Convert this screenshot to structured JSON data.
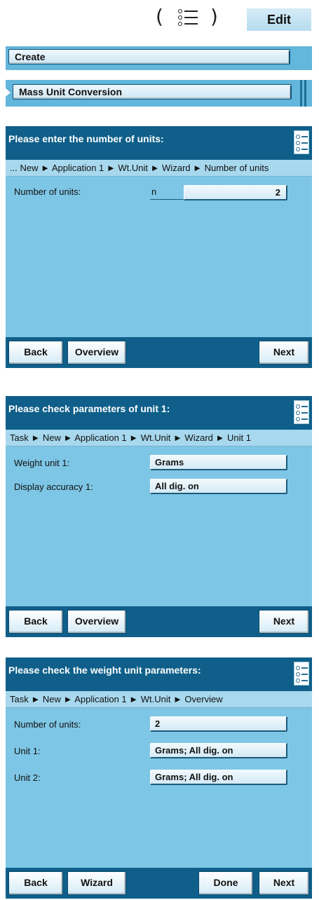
{
  "top_bar": {
    "paren_left": "(",
    "paren_right": ")",
    "menu_icon": "list-icon",
    "edit_label": "Edit"
  },
  "create_bar": {
    "label": "Create"
  },
  "mass_bar": {
    "label": "Mass Unit Conversion",
    "expanded_icon": "play-triangle-icon"
  },
  "screen1": {
    "title": "Please enter the number of units:",
    "breadcrumb": "... New ► Application 1 ► Wt.Unit ► Wizard ► Number of units",
    "fields": [
      {
        "label": "Number of units:",
        "prefix": "n",
        "value": "2"
      }
    ],
    "footer": {
      "back": "Back",
      "overview": "Overview",
      "next": "Next"
    }
  },
  "screen2": {
    "title": "Please check parameters of unit 1:",
    "breadcrumb": "Task ► New ► Application 1 ► Wt.Unit ► Wizard ► Unit 1",
    "fields": [
      {
        "label": "Weight unit 1:",
        "value": "Grams"
      },
      {
        "label": "Display accuracy 1:",
        "value": "All dig. on"
      }
    ],
    "footer": {
      "back": "Back",
      "overview": "Overview",
      "next": "Next"
    }
  },
  "screen3": {
    "title": "Please check the weight unit parameters:",
    "breadcrumb": "Task ► New ► Application 1 ► Wt.Unit ► Overview",
    "fields": [
      {
        "label": "Number of units:",
        "value": "2"
      },
      {
        "label": "Unit 1:",
        "value": "Grams; All dig. on"
      },
      {
        "label": "Unit 2:",
        "value": "Grams; All dig. on"
      }
    ],
    "footer": {
      "back": "Back",
      "wizard": "Wizard",
      "done": "Done",
      "next": "Next"
    }
  },
  "colors": {
    "header_dark": "#0f5f8a",
    "panel_light": "#7ec6e5",
    "breadcrumb_bg": "#a7d8ee",
    "bar_mid": "#63b6dc"
  }
}
